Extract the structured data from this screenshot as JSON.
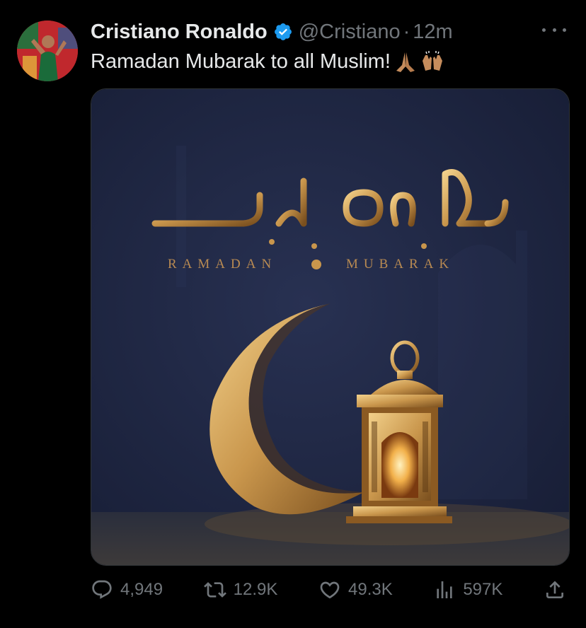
{
  "author": {
    "name": "Cristiano Ronaldo",
    "handle": "@Cristiano",
    "separator": "·",
    "time": "12m",
    "verified": true,
    "verified_color": "#1d9bf0"
  },
  "tweet": {
    "text": "Ramadan Mubarak to all Muslim!",
    "emojis": [
      "folded-hands-emoji",
      "raising-hands-emoji"
    ]
  },
  "media": {
    "caption_left": "RAMADAN",
    "caption_right": "MUBARAK",
    "calligraphy": "رمضان مبارك",
    "background_color": "#1f2742",
    "gold_color": "#c9964c"
  },
  "actions": {
    "replies": "4,949",
    "retweets": "12.9K",
    "likes": "49.3K",
    "views": "597K"
  },
  "colors": {
    "background": "#000000",
    "text_primary": "#e7e9ea",
    "text_secondary": "#71767b"
  }
}
